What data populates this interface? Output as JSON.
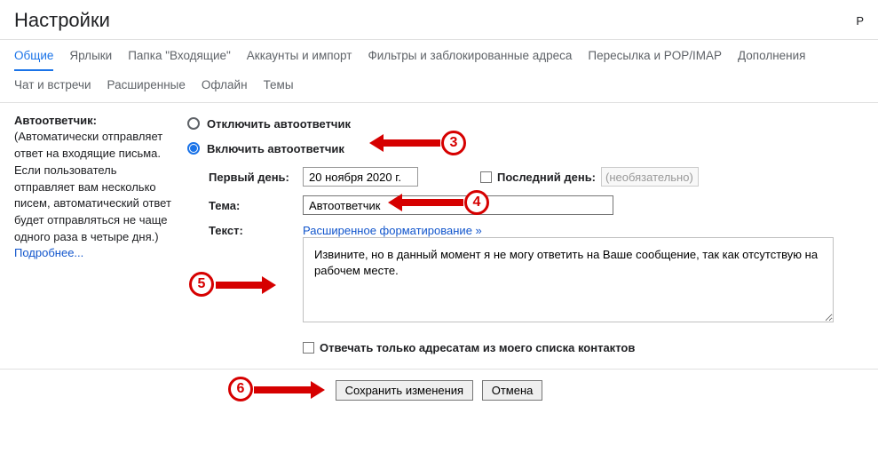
{
  "header": {
    "title": "Настройки",
    "lang": "Р"
  },
  "tabs": {
    "row1": [
      "Общие",
      "Ярлыки",
      "Папка \"Входящие\"",
      "Аккаунты и импорт",
      "Фильтры и заблокированные адреса",
      "Пересылка и POP/IMAP",
      "Дополнения"
    ],
    "row2": [
      "Чат и встречи",
      "Расширенные",
      "Офлайн",
      "Темы"
    ],
    "activeIndex": 0
  },
  "autoresponder": {
    "label": "Автоответчик:",
    "desc": "(Автоматически отправляет ответ на входящие письма. Если пользователь отправляет вам несколько писем, автоматический ответ будет отправляться не чаще одного раза в четыре дня.)",
    "more": "Подробнее...",
    "off_label": "Отключить автоответчик",
    "on_label": "Включить автоответчик",
    "first_day_label": "Первый день:",
    "first_day_value": "20 ноября 2020 г.",
    "last_day_label": "Последний день:",
    "last_day_placeholder": "(необязательно)",
    "subject_label": "Тема:",
    "subject_value": "Автоответчик",
    "body_label": "Текст:",
    "format_link": "Расширенное форматирование »",
    "body_value": "Извините, но в данный момент я не могу ответить на Ваше сообщение, так как отсутствую на рабочем месте.",
    "contacts_only_label": "Отвечать только адресатам из моего списка контактов"
  },
  "footer": {
    "save": "Сохранить изменения",
    "cancel": "Отмена"
  },
  "annotations": {
    "n3": "3",
    "n4": "4",
    "n5": "5",
    "n6": "6"
  }
}
